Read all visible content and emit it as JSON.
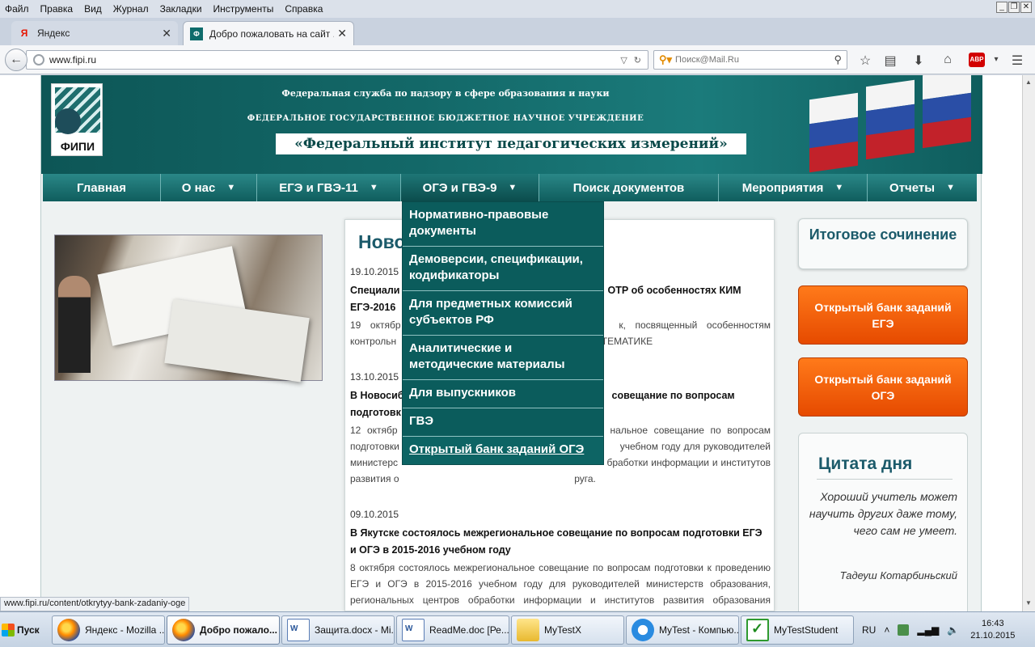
{
  "menubar": [
    "Файл",
    "Правка",
    "Вид",
    "Журнал",
    "Закладки",
    "Инструменты",
    "Справка"
  ],
  "window_controls": [
    "_",
    "❐",
    "✕"
  ],
  "tabs": [
    {
      "label": "Яндекс",
      "favicon": "Я",
      "icon": "yandex-favicon"
    },
    {
      "label": "Добро пожаловать на сайт ...",
      "favicon": "Ф",
      "icon": "fipi-favicon"
    }
  ],
  "tab_close": "✕",
  "new_tab": "+",
  "url": "www.fipi.ru",
  "search_placeholder": "Поиск@Mail.Ru",
  "abp": "ABP",
  "header": {
    "line1": "Федеральная служба по надзору в сфере образования и науки",
    "line2": "ФЕДЕРАЛЬНОЕ ГОСУДАРСТВЕННОЕ БЮДЖЕТНОЕ НАУЧНОЕ УЧРЕЖДЕНИЕ",
    "line3": "«Федеральный институт педагогических измерений»",
    "logo_text": "ФИПИ"
  },
  "nav": [
    {
      "label": "Главная",
      "caret": ""
    },
    {
      "label": "О нас",
      "caret": "▼"
    },
    {
      "label": "ЕГЭ и ГВЭ-11",
      "caret": "▼"
    },
    {
      "label": "ОГЭ и ГВЭ-9",
      "caret": "▼"
    },
    {
      "label": "Поиск документов",
      "caret": ""
    },
    {
      "label": "Мероприятия",
      "caret": "▼"
    },
    {
      "label": "Отчеты",
      "caret": "▼"
    }
  ],
  "dropdown": [
    "Нормативно-правовые документы",
    "Демоверсии, спецификации, кодификаторы",
    "Для предметных комиссий субъектов РФ",
    "Аналитические и методические материалы",
    "Для выпускников",
    "ГВЭ",
    "Открытый банк заданий ОГЭ"
  ],
  "news_heading": "Новос",
  "news": [
    {
      "date": "19.10.2015",
      "title": "Специали                                                                          ОТР об особенностях КИМ ЕГЭ-2016",
      "body": "19   октябр                                                                      к,   посвященный   особенностям контрольн                                                                  по МАТЕМАТИКЕ"
    },
    {
      "date": "13.10.2015",
      "title": "В Новосиб                                                                          совещание по вопросам подготовк",
      "body": "12  октябр                                                                     нальное  совещание  по  вопросам подготовки                                                                    учебном году для руководителей министерс                                                                   бработки информации и институтов развития о                                                                 руга."
    },
    {
      "date": "09.10.2015",
      "title": "В Якутске состоялось межрегиональное совещание по вопросам подготовки ЕГЭ и ОГЭ в 2015-2016 учебном году",
      "body": "8 октября состоялось межрегиональное совещание по вопросам подготовки к проведению ЕГЭ и ОГЭ в 2015-2016 учебном году для руководителей министерств образования, региональных центров обработки информации и институтов развития образования Дальневосточного федерального округа"
    }
  ],
  "sidebar": {
    "essay": "Итоговое сочинение",
    "bank_ege": "Открытый банк заданий ЕГЭ",
    "bank_oge": "Открытый банк заданий ОГЭ",
    "quote_title": "Цитата дня",
    "quote_text": "Хороший учитель может научить других даже тому, чего сам не умеет.",
    "quote_author": "Тадеуш Котарбиньский"
  },
  "status_url": "www.fipi.ru/content/otkrytyy-bank-zadaniy-oge",
  "taskbar": {
    "start": "Пуск",
    "items": [
      {
        "label": "Яндекс - Mozilla ...",
        "icon": "ff"
      },
      {
        "label": "Добро пожало...",
        "icon": "ff"
      },
      {
        "label": "Защита.docx - Mi...",
        "icon": "doc"
      },
      {
        "label": "ReadMe.doc [Ре...",
        "icon": "doc"
      },
      {
        "label": "MyTestX",
        "icon": "folder"
      },
      {
        "label": "MyTest - Компью...",
        "icon": "ie"
      },
      {
        "label": "MyTestStudent",
        "icon": "check"
      }
    ],
    "lang": "RU",
    "time": "16:43",
    "date": "21.10.2015"
  }
}
